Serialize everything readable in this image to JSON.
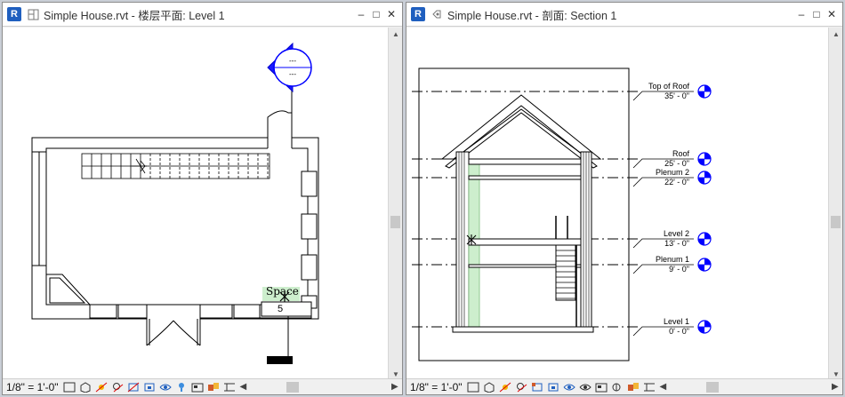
{
  "views": {
    "left": {
      "app_badge": "R",
      "title": "Simple House.rvt - 楼层平面: Level 1",
      "scale": "1/8\" = 1'-0\"",
      "room": {
        "name": "Space",
        "number": "5"
      },
      "elevation_marker": {
        "top": "---",
        "bottom": "---"
      }
    },
    "right": {
      "app_badge": "R",
      "title": "Simple House.rvt - 剖面: Section 1",
      "scale": "1/8\" = 1'-0\"",
      "levels": [
        {
          "name": "Top of Roof",
          "elevation": "35' - 0\""
        },
        {
          "name": "Roof",
          "elevation": "25' - 0\""
        },
        {
          "name": "Plenum 2",
          "elevation": "22' - 0\""
        },
        {
          "name": "Level 2",
          "elevation": "13' - 0\""
        },
        {
          "name": "Plenum 1",
          "elevation": "9' - 0\""
        },
        {
          "name": "Level 1",
          "elevation": "0' - 0\""
        }
      ]
    }
  },
  "window_buttons": {
    "minimize": "–",
    "maximize": "□",
    "close": "✕"
  },
  "colors": {
    "accent": "#1f5fbf",
    "marker_blue": "#0000ff",
    "space_fill": "#cdeecd"
  }
}
